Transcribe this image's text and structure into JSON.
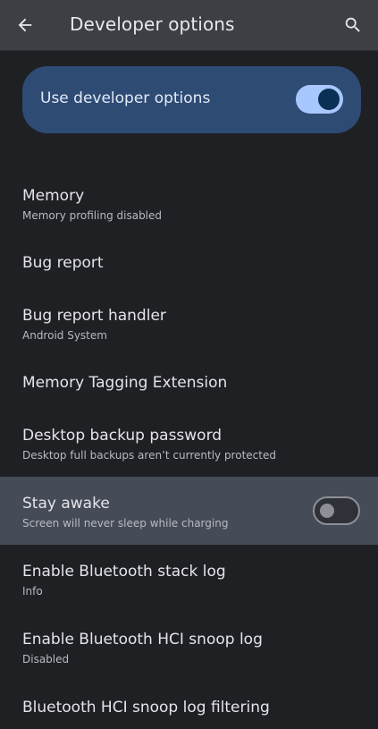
{
  "header": {
    "title": "Developer options",
    "back_icon": "arrow-back-icon",
    "search_icon": "search-icon"
  },
  "master_toggle": {
    "label": "Use developer options",
    "checked": true
  },
  "settings": [
    {
      "title": "Memory",
      "subtitle": "Memory profiling disabled"
    },
    {
      "title": "Bug report"
    },
    {
      "title": "Bug report handler",
      "subtitle": "Android System"
    },
    {
      "title": "Memory Tagging Extension"
    },
    {
      "title": "Desktop backup password",
      "subtitle": "Desktop full backups aren’t currently protected"
    },
    {
      "title": "Stay awake",
      "subtitle": "Screen will never sleep while charging",
      "toggle": false
    },
    {
      "title": "Enable Bluetooth stack log",
      "subtitle": "Info"
    },
    {
      "title": "Enable Bluetooth HCI snoop log",
      "subtitle": "Disabled"
    },
    {
      "title": "Bluetooth HCI snoop log filtering"
    }
  ],
  "colors": {
    "background": "#1f2024",
    "topbar": "#3c3f44",
    "master_card": "#2e4b74",
    "switch_on_track": "#a9c7ff",
    "switch_on_thumb": "#0b3056",
    "highlight_row": "#454b57"
  }
}
